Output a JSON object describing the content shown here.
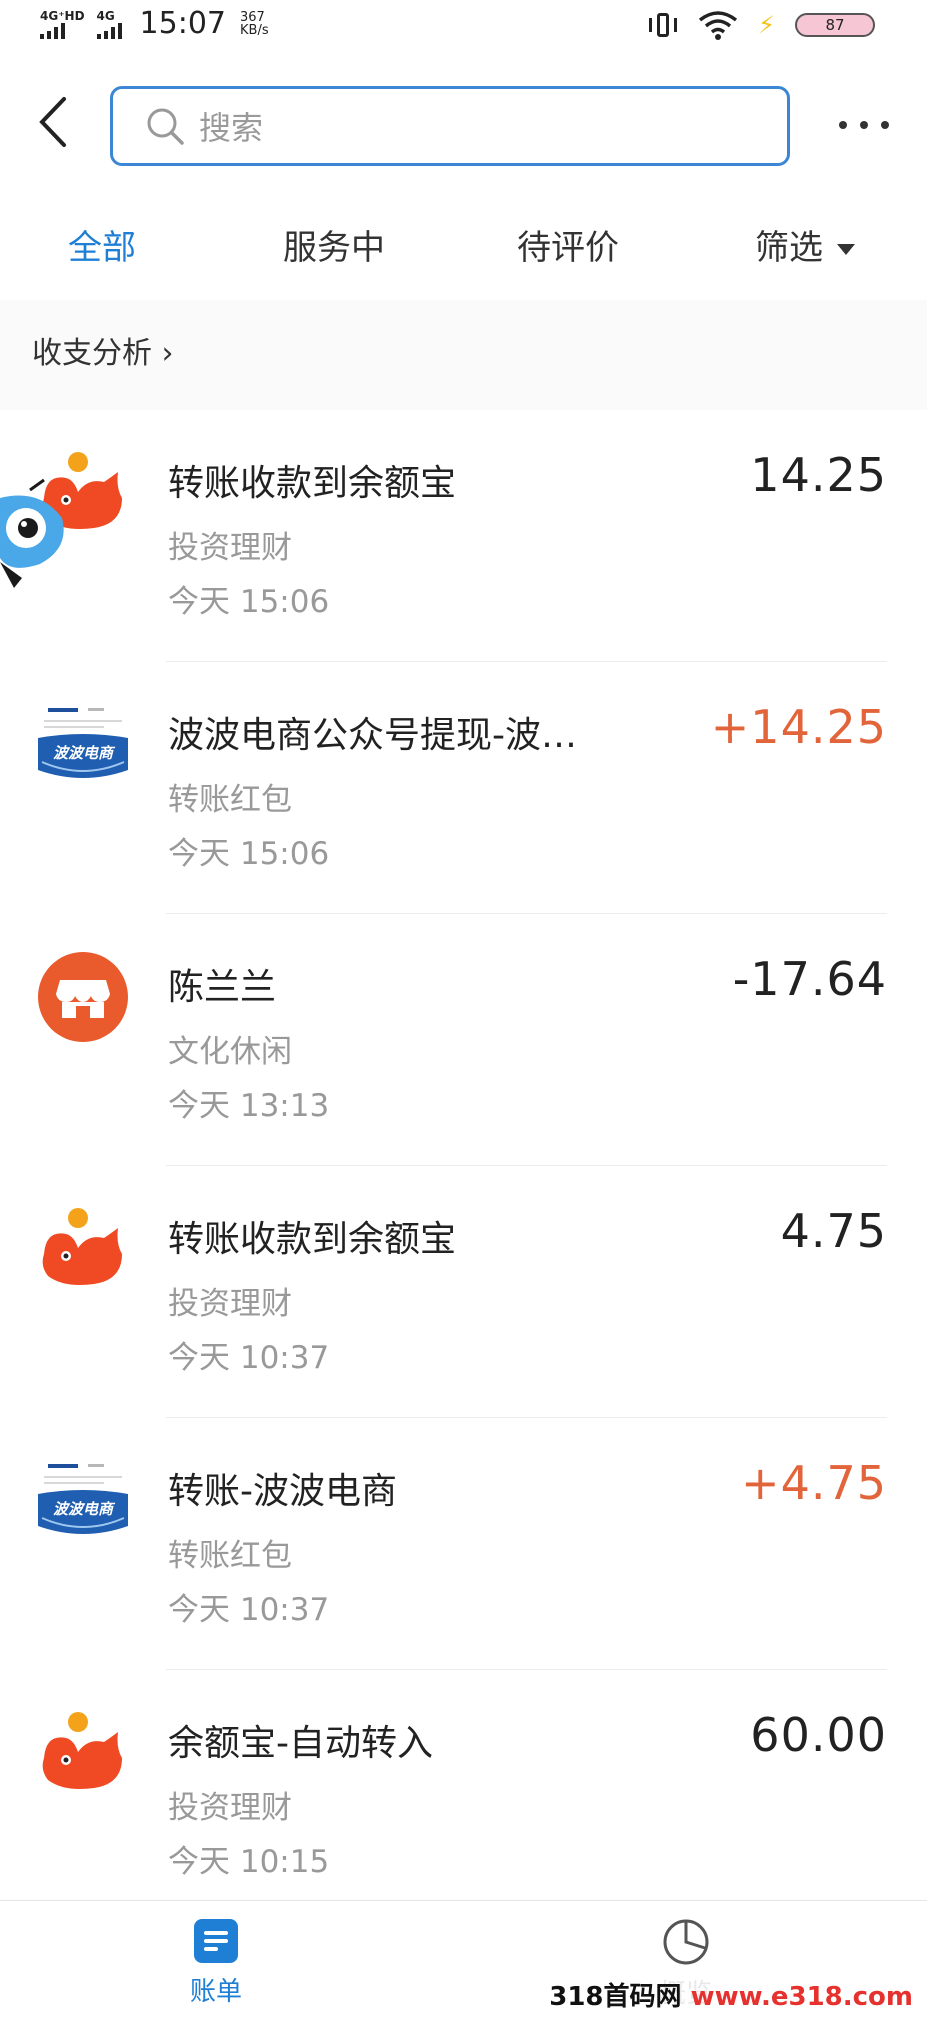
{
  "status_bar": {
    "net1": "4G⁺HD",
    "net2": "4G",
    "time": "15:07",
    "speed_value": "367",
    "speed_unit": "KB/s",
    "battery": "87"
  },
  "header": {
    "search_placeholder": "搜索"
  },
  "tabs": [
    {
      "label": "全部",
      "active": true
    },
    {
      "label": "服务中",
      "active": false
    },
    {
      "label": "待评价",
      "active": false
    },
    {
      "label": "筛选",
      "active": false
    }
  ],
  "analysis_link": "收支分析 ›",
  "transactions": [
    {
      "title": "转账收款到余额宝",
      "category": "投资理财",
      "time": "今天  15:06",
      "amount": "14.25",
      "type": "yuebao"
    },
    {
      "title": "波波电商公众号提现-波…",
      "category": "转账红包",
      "time": "今天  15:06",
      "amount": "+14.25",
      "type": "bobo"
    },
    {
      "title": "陈兰兰",
      "category": "文化休闲",
      "time": "今天  13:13",
      "amount": "-17.64",
      "type": "shop"
    },
    {
      "title": "转账收款到余额宝",
      "category": "投资理财",
      "time": "今天  10:37",
      "amount": "4.75",
      "type": "yuebao"
    },
    {
      "title": "转账-波波电商",
      "category": "转账红包",
      "time": "今天  10:37",
      "amount": "+4.75",
      "type": "bobo"
    },
    {
      "title": "余额宝-自动转入",
      "category": "投资理财",
      "time": "今天  10:15",
      "amount": "60.00",
      "type": "yuebao"
    }
  ],
  "bobo_logo_text": "波波电商",
  "bottom_nav": {
    "bill": "账单",
    "overview": "概览"
  },
  "watermark": {
    "prefix": "318首码网 ",
    "site": "www.e318.com"
  },
  "colors": {
    "accent": "#1f7fd4",
    "income": "#e2643a",
    "yuebao": "#ef4a23",
    "shop": "#e95a2c"
  }
}
